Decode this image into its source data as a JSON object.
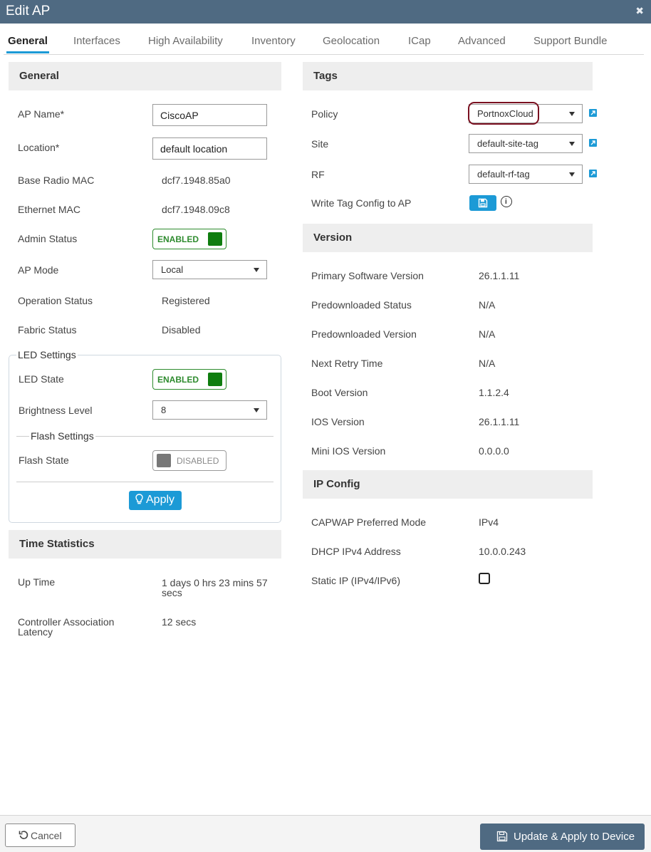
{
  "window": {
    "title": "Edit AP",
    "close_icon": "close-icon"
  },
  "tabs": [
    {
      "label": "General",
      "active": true
    },
    {
      "label": "Interfaces"
    },
    {
      "label": "High Availability"
    },
    {
      "label": "Inventory"
    },
    {
      "label": "Geolocation"
    },
    {
      "label": "ICap"
    },
    {
      "label": "Advanced"
    },
    {
      "label": "Support Bundle"
    }
  ],
  "general": {
    "heading": "General",
    "ap_name": {
      "label": "AP Name*",
      "value": "CiscoAP"
    },
    "location": {
      "label": "Location*",
      "value": "default location"
    },
    "base_radio_mac": {
      "label": "Base Radio MAC",
      "value": "dcf7.1948.85a0"
    },
    "ethernet_mac": {
      "label": "Ethernet MAC",
      "value": "dcf7.1948.09c8"
    },
    "admin_status": {
      "label": "Admin Status",
      "value": "ENABLED"
    },
    "ap_mode": {
      "label": "AP Mode",
      "value": "Local"
    },
    "operation_status": {
      "label": "Operation Status",
      "value": "Registered"
    },
    "fabric_status": {
      "label": "Fabric Status",
      "value": "Disabled"
    }
  },
  "led_settings": {
    "legend": "LED Settings",
    "led_state": {
      "label": "LED State",
      "value": "ENABLED"
    },
    "brightness": {
      "label": "Brightness Level",
      "value": "8"
    },
    "flash_legend": "Flash Settings",
    "flash_state": {
      "label": "Flash State",
      "value": "DISABLED"
    },
    "apply_label": "Apply",
    "apply_icon": "lightbulb-icon"
  },
  "time_statistics": {
    "heading": "Time Statistics",
    "up_time": {
      "label": "Up Time",
      "value_line1": "1 days 0 hrs 23 mins 57",
      "value_line2": "secs"
    },
    "controller_latency": {
      "label_line1": "Controller Association",
      "label_line2": "Latency",
      "value": "12 secs"
    }
  },
  "tags": {
    "heading": "Tags",
    "policy": {
      "label": "Policy",
      "value": "PortnoxCloud"
    },
    "site": {
      "label": "Site",
      "value": "default-site-tag"
    },
    "rf": {
      "label": "RF",
      "value": "default-rf-tag"
    },
    "write_tag": {
      "label": "Write Tag Config to AP",
      "icon": "save-icon",
      "info_icon": "info-icon"
    },
    "highlight_color": "#7a1020"
  },
  "version": {
    "heading": "Version",
    "rows": [
      {
        "label": "Primary Software Version",
        "value": "26.1.1.11"
      },
      {
        "label": "Predownloaded Status",
        "value": "N/A"
      },
      {
        "label": "Predownloaded Version",
        "value": "N/A"
      },
      {
        "label": "Next Retry Time",
        "value": "N/A"
      },
      {
        "label": "Boot Version",
        "value": "1.1.2.4"
      },
      {
        "label": "IOS Version",
        "value": "26.1.1.11"
      },
      {
        "label": "Mini IOS Version",
        "value": "0.0.0.0"
      }
    ]
  },
  "ip_config": {
    "heading": "IP Config",
    "capwap": {
      "label": "CAPWAP Preferred Mode",
      "value": "IPv4"
    },
    "dhcp": {
      "label": "DHCP IPv4 Address",
      "value": "10.0.0.243"
    },
    "static_ip": {
      "label": "Static IP (IPv4/IPv6)",
      "checked": false
    }
  },
  "footer": {
    "cancel_label": "Cancel",
    "cancel_icon": "undo-icon",
    "update_label": "Update & Apply to Device",
    "update_icon": "save-icon"
  },
  "colors": {
    "titlebar": "#4f6a82",
    "accent": "#1c9ad6",
    "enabled_green": "#0f7d0f",
    "section_bg": "#eeeeee"
  }
}
